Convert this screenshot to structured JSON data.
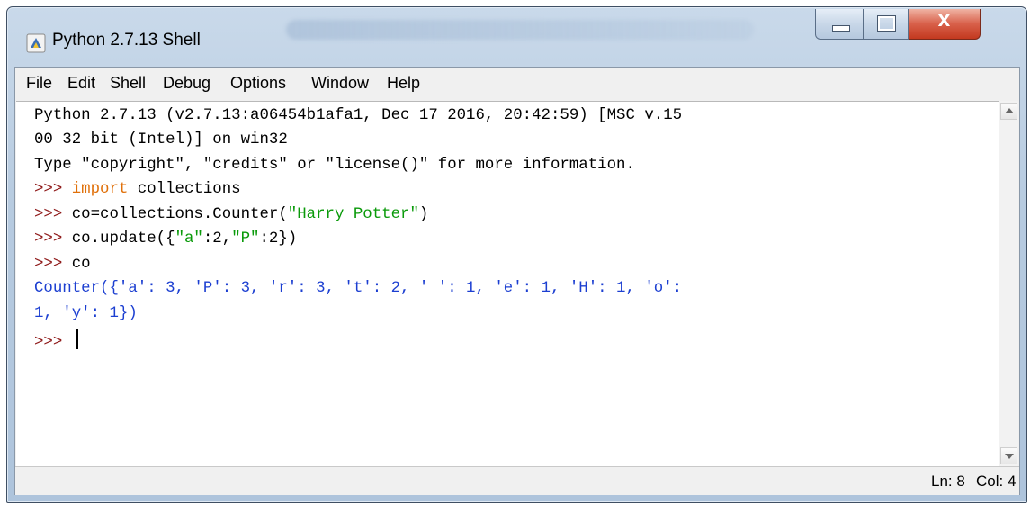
{
  "window": {
    "title": "Python 2.7.13 Shell",
    "app_icon": "idle-python-icon",
    "controls": {
      "minimize": "minimize-icon",
      "maximize": "maximize-icon",
      "close_label": "X"
    }
  },
  "menu": {
    "items": [
      "File",
      "Edit",
      "Shell",
      "Debug",
      "Options",
      "Window",
      "Help"
    ]
  },
  "shell": {
    "banner_line1": "Python 2.7.13 (v2.7.13:a06454b1afa1, Dec 17 2016, 20:42:59) [MSC v.15",
    "banner_line2": "00 32 bit (Intel)] on win32",
    "banner_line3": "Type \"copyright\", \"credits\" or \"license()\" for more information.",
    "prompt": ">>> ",
    "cmd1_keyword": "import",
    "cmd1_rest": " collections",
    "cmd2_code": "co=collections.Counter(",
    "cmd2_string": "\"Harry Potter\"",
    "cmd2_close": ")",
    "cmd3_a": "co.update({",
    "cmd3_s1": "\"a\"",
    "cmd3_b": ":2,",
    "cmd3_s2": "\"P\"",
    "cmd3_c": ":2})",
    "cmd4": "co",
    "output_line1": "Counter({'a': 3, 'P': 3, 'r': 3, 't': 2, ' ': 1, 'e': 1, 'H': 1, 'o':",
    "output_line2": "1, 'y': 1})",
    "final_prompt": ">>> "
  },
  "status": {
    "line": "Ln: 8",
    "col": "Col: 4"
  },
  "colors": {
    "prompt": "#8f1a1a",
    "keyword": "#e0700a",
    "string": "#0a9a0a",
    "output": "#1c3fd1"
  }
}
